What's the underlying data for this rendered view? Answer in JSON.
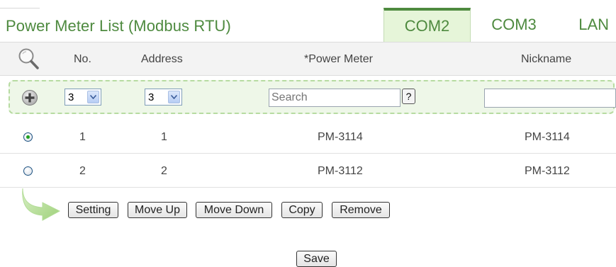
{
  "title": "Power Meter List (Modbus RTU)",
  "tabs": [
    {
      "label": "COM2",
      "active": true
    },
    {
      "label": "COM3",
      "active": false
    },
    {
      "label": "LAN",
      "active": false
    }
  ],
  "table": {
    "columns": [
      "No.",
      "Address",
      "*Power Meter",
      "Nickname"
    ],
    "rows": [
      {
        "selected": true,
        "no": "1",
        "address": "1",
        "power_meter": "PM-3114",
        "nickname": "PM-3114"
      },
      {
        "selected": false,
        "no": "2",
        "address": "2",
        "power_meter": "PM-3112",
        "nickname": "PM-3112"
      }
    ]
  },
  "add_row": {
    "no_value": "3",
    "address_value": "3",
    "search_placeholder": "Search",
    "help_label": "?",
    "nickname_value": ""
  },
  "actions": {
    "setting": "Setting",
    "move_up": "Move Up",
    "move_down": "Move Down",
    "copy": "Copy",
    "remove": "Remove"
  },
  "save_label": "Save",
  "colors": {
    "accent_green": "#4e8a3f",
    "active_tab_bg": "#e6f5d9",
    "add_row_bg": "#eef7e8",
    "radio_selected": "#21a121"
  },
  "icons": {
    "search": "magnifier-icon",
    "add": "plus-circle-icon",
    "arrow": "curved-arrow-icon"
  }
}
